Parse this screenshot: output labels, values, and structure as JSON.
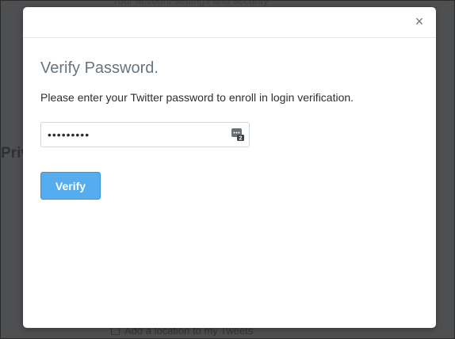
{
  "background": {
    "top_text": "Your account settings and security",
    "side_heading": "Privacy",
    "location_label": "Add a location to my Tweets"
  },
  "modal": {
    "close_glyph": "×",
    "title": "Verify Password.",
    "description": "Please enter your Twitter password to enroll in login verification.",
    "password": {
      "value": "•••••••••",
      "placeholder": ""
    },
    "password_manager_icon": "password-manager-icon",
    "verify_label": "Verify"
  },
  "colors": {
    "overlay": "#4e4f51",
    "accent": "#55acee",
    "title": "#66757f",
    "text": "#292f33"
  }
}
